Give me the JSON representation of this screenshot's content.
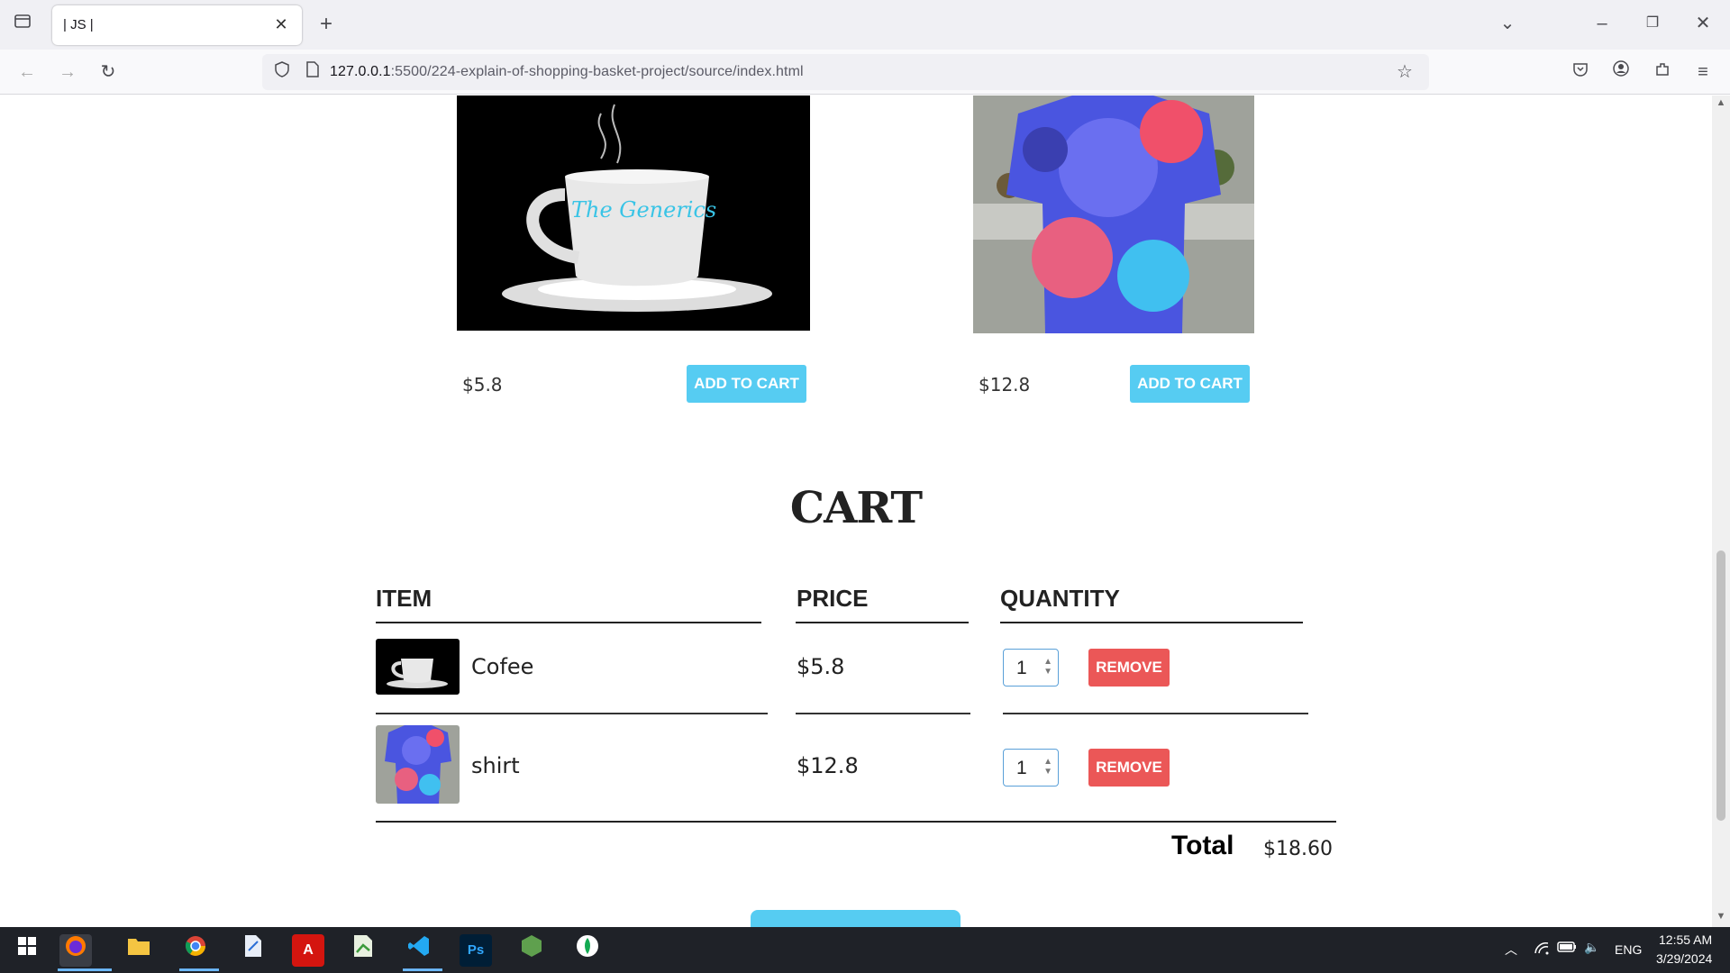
{
  "browser": {
    "tab_title": "| JS |",
    "url_host": "127.0.0.1",
    "url_rest": ":5500/224-explain-of-shopping-basket-project/source/index.html"
  },
  "products": [
    {
      "name": "Cofee",
      "price": "$5.8",
      "button": "ADD TO CART",
      "image_text": "The Generics"
    },
    {
      "name": "shirt",
      "price": "$12.8",
      "button": "ADD TO CART"
    }
  ],
  "cart": {
    "title": "CART",
    "headers": {
      "item": "ITEM",
      "price": "PRICE",
      "quantity": "QUANTITY"
    },
    "rows": [
      {
        "name": "Cofee",
        "price": "$5.8",
        "qty": "1",
        "remove": "REMOVE"
      },
      {
        "name": "shirt",
        "price": "$12.8",
        "qty": "1",
        "remove": "REMOVE"
      }
    ],
    "total_label": "Total",
    "total_value": "$18.60"
  },
  "taskbar": {
    "lang": "ENG",
    "time": "12:55 AM",
    "date": "3/29/2024"
  }
}
